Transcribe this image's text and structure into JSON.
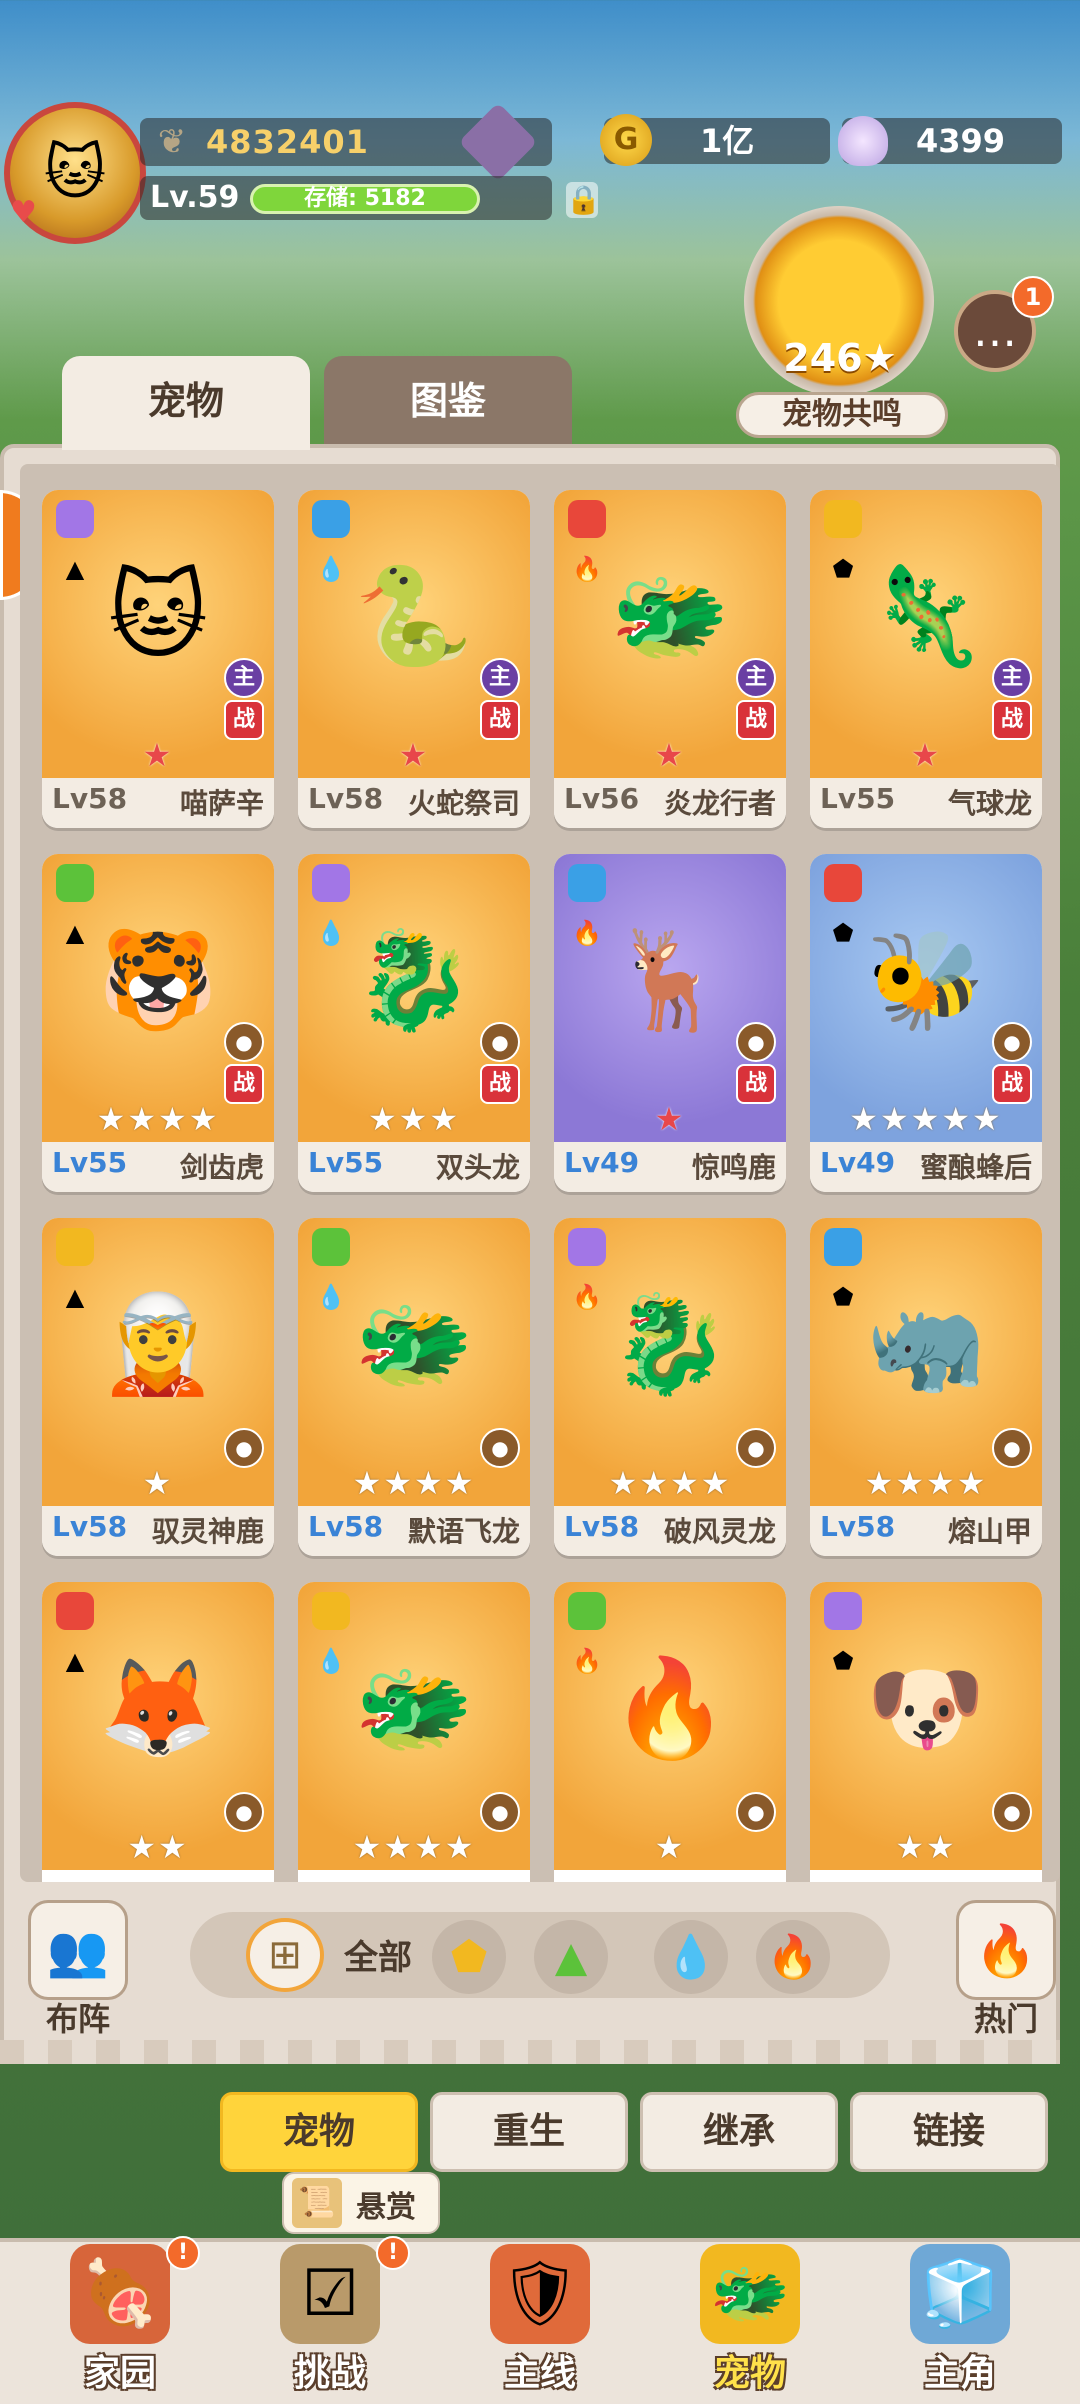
{
  "player": {
    "power": "4832401",
    "level": "Lv.59",
    "storage": "存储: 5182",
    "avatar_icon": "hooded-cat-hero"
  },
  "currency": {
    "gold": "1亿",
    "shells": "4399"
  },
  "resonance": {
    "value": "246",
    "label": "宠物共鸣"
  },
  "chat": {
    "badge": "1"
  },
  "tabs": {
    "pets": "宠物",
    "codex": "图鉴"
  },
  "pets": [
    {
      "level": "Lv58",
      "name": "喵萨辛",
      "bg": "orange",
      "emoji": "🐱",
      "badge1": "主",
      "badge2": "战",
      "stars": 1,
      "star_style": "red"
    },
    {
      "level": "Lv58",
      "name": "火蛇祭司",
      "bg": "orange",
      "emoji": "🐍",
      "badge1": "主",
      "badge2": "战",
      "stars": 1,
      "star_style": "red"
    },
    {
      "level": "Lv56",
      "name": "炎龙行者",
      "bg": "orange",
      "emoji": "🐲",
      "badge1": "主",
      "badge2": "战",
      "stars": 1,
      "star_style": "red"
    },
    {
      "level": "Lv55",
      "name": "气球龙",
      "bg": "orange",
      "emoji": "🦎",
      "badge1": "主",
      "badge2": "战",
      "stars": 1,
      "star_style": "red"
    },
    {
      "level": "Lv55",
      "name": "剑齿虎",
      "bg": "orange",
      "emoji": "🐯",
      "badge1": "",
      "badge2": "战",
      "stars": 4,
      "star_style": "white"
    },
    {
      "level": "Lv55",
      "name": "双头龙",
      "bg": "orange",
      "emoji": "🐉",
      "badge1": "",
      "badge2": "战",
      "stars": 3,
      "star_style": "white"
    },
    {
      "level": "Lv49",
      "name": "惊鸣鹿",
      "bg": "purple",
      "emoji": "🦌",
      "badge1": "",
      "badge2": "战",
      "stars": 1,
      "star_style": "red"
    },
    {
      "level": "Lv49",
      "name": "蜜酿蜂后",
      "bg": "blue",
      "emoji": "🐝",
      "badge1": "",
      "badge2": "战",
      "stars": 5,
      "star_style": "white"
    },
    {
      "level": "Lv58",
      "name": "驭灵神鹿",
      "bg": "orange",
      "emoji": "🧝",
      "badge1": "",
      "badge2": "",
      "stars": 1,
      "star_style": "white"
    },
    {
      "level": "Lv58",
      "name": "默语飞龙",
      "bg": "orange",
      "emoji": "🐲",
      "badge1": "",
      "badge2": "",
      "stars": 4,
      "star_style": "white"
    },
    {
      "level": "Lv58",
      "name": "破风灵龙",
      "bg": "orange",
      "emoji": "🐉",
      "badge1": "",
      "badge2": "",
      "stars": 4,
      "star_style": "white"
    },
    {
      "level": "Lv58",
      "name": "熔山甲",
      "bg": "orange",
      "emoji": "🦏",
      "badge1": "",
      "badge2": "",
      "stars": 4,
      "star_style": "white"
    },
    {
      "level": "",
      "name": "",
      "bg": "orange",
      "emoji": "🦊",
      "badge1": "",
      "badge2": "",
      "stars": 2,
      "star_style": "white"
    },
    {
      "level": "",
      "name": "",
      "bg": "orange",
      "emoji": "🐲",
      "badge1": "",
      "badge2": "",
      "stars": 4,
      "star_style": "white"
    },
    {
      "level": "",
      "name": "",
      "bg": "orange",
      "emoji": "🔥",
      "badge1": "",
      "badge2": "",
      "stars": 1,
      "star_style": "white"
    },
    {
      "level": "",
      "name": "",
      "bg": "orange",
      "emoji": "🐶",
      "badge1": "",
      "badge2": "",
      "stars": 2,
      "star_style": "white"
    }
  ],
  "filters": {
    "formation": "布阵",
    "all": "全部",
    "hot": "热门",
    "elements": [
      "earth",
      "grass",
      "water",
      "fire"
    ]
  },
  "actions": [
    "宠物",
    "重生",
    "继承",
    "链接"
  ],
  "bounty": {
    "label": "悬赏"
  },
  "nav": [
    {
      "label": "家园",
      "icon": "home-meat-icon",
      "dot": "!"
    },
    {
      "label": "挑战",
      "icon": "challenge-scroll-icon",
      "dot": "!"
    },
    {
      "label": "主线",
      "icon": "mainline-shield-icon",
      "dot": ""
    },
    {
      "label": "宠物",
      "icon": "pet-dragon-icon",
      "dot": ""
    },
    {
      "label": "主角",
      "icon": "hero-cube-icon",
      "dot": ""
    }
  ]
}
